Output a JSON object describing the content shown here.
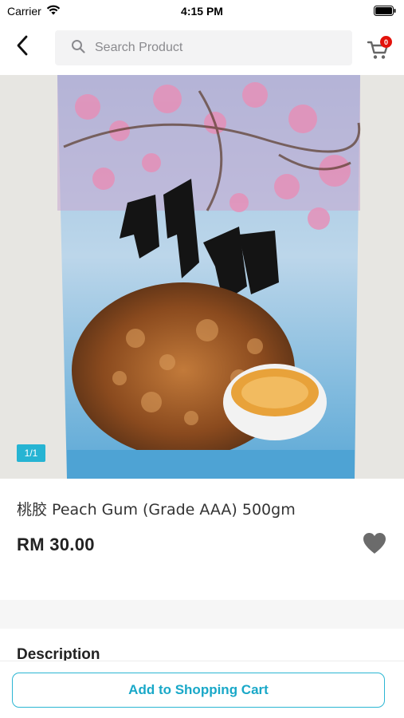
{
  "status_bar": {
    "carrier": "Carrier",
    "time": "4:15 PM"
  },
  "nav": {
    "back_icon": "chevron-left-icon",
    "search_placeholder": "Search Product",
    "search_icon": "search-icon",
    "cart_icon": "cart-icon",
    "cart_count": "0"
  },
  "product": {
    "image_counter": "1/1",
    "title": "桃胶 Peach Gum (Grade AAA) 500gm",
    "price": "RM 30.00",
    "wishlist_icon": "heart-icon"
  },
  "description": {
    "title": "Description"
  },
  "actions": {
    "add_to_cart_label": "Add to Shopping Cart"
  },
  "colors": {
    "accent": "#2bb6d3",
    "badge": "#e3120b",
    "counter_bg": "#26b4d3",
    "heart": "#6b6b6b"
  }
}
